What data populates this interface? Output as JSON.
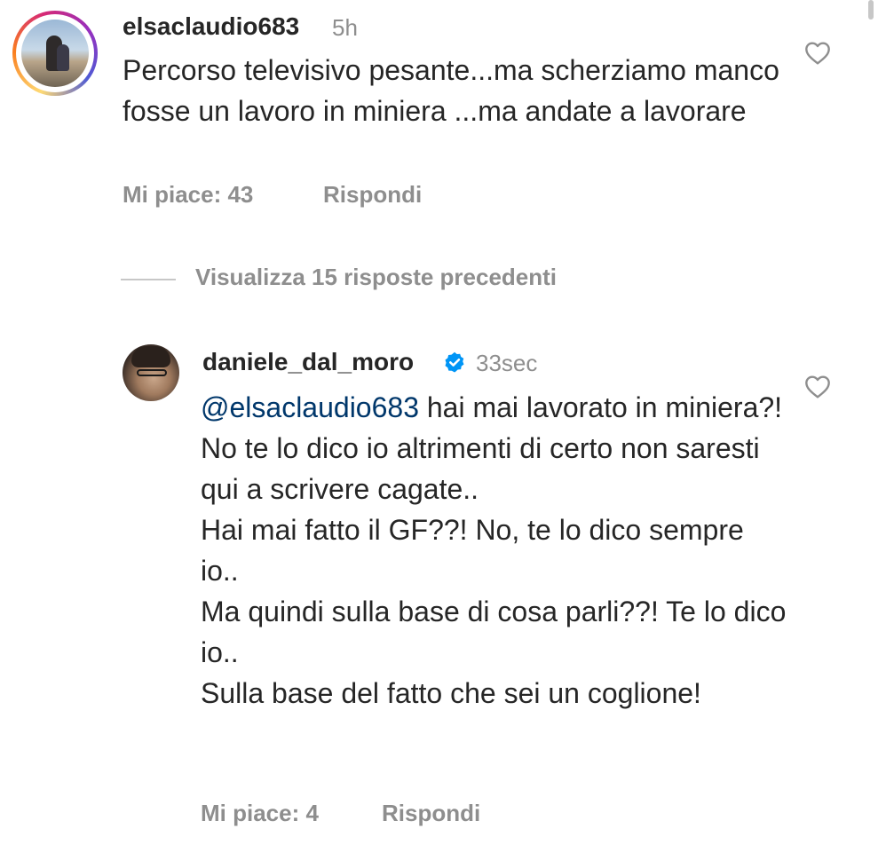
{
  "comments": [
    {
      "username": "elsaclaudio683",
      "time": "5h",
      "text": "Percorso televisivo pesante...ma scherziamo manco fosse un lavoro in miniera ...ma andate a lavorare",
      "likes": "Mi piace: 43",
      "reply": "Rispondi"
    },
    {
      "username": "daniele_dal_moro",
      "time": "33sec",
      "mention": "@elsaclaudio683",
      "paragraphs": [
        " hai mai lavorato in miniera?! No te lo dico io altrimenti di certo non saresti qui a scrivere cagate..",
        "Hai mai fatto il GF??! No, te lo dico sempre io..",
        "Ma quindi sulla base di cosa parli??! Te lo dico io..",
        "Sulla base del fatto che sei un coglione!"
      ],
      "likes": "Mi piace: 4",
      "reply": "Rispondi"
    }
  ],
  "view_replies": "Visualizza 15 risposte precedenti",
  "colors": {
    "text": "#262626",
    "secondary": "#8e8e8e",
    "mention": "#00376b",
    "verified": "#0095f6"
  },
  "icons": [
    "heart-icon",
    "verified-badge-icon"
  ]
}
